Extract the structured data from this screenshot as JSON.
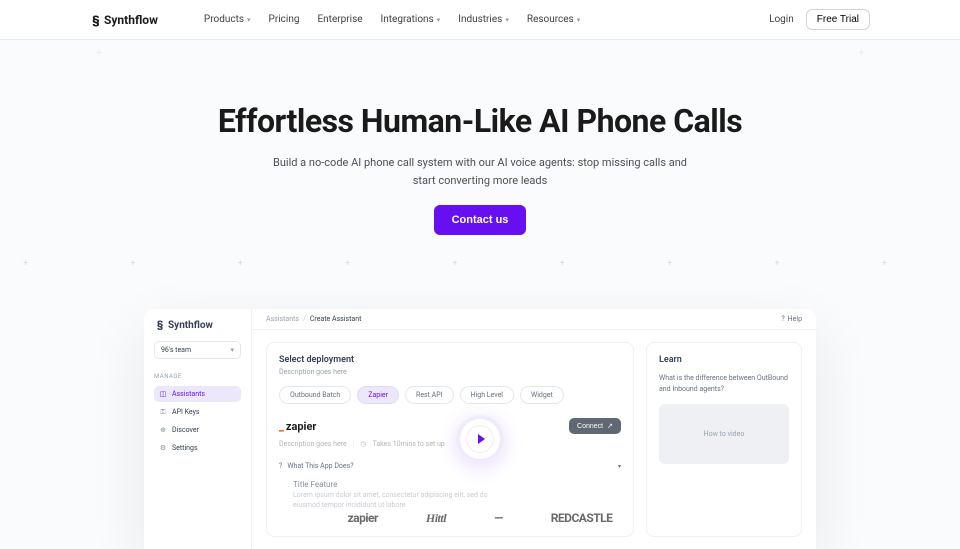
{
  "brand": "Synthflow",
  "nav": {
    "items": [
      {
        "label": "Products",
        "dropdown": true
      },
      {
        "label": "Pricing",
        "dropdown": false
      },
      {
        "label": "Enterprise",
        "dropdown": false
      },
      {
        "label": "Integrations",
        "dropdown": true
      },
      {
        "label": "Industries",
        "dropdown": true
      },
      {
        "label": "Resources",
        "dropdown": true
      }
    ],
    "login": "Login",
    "trial": "Free Trial"
  },
  "hero": {
    "title": "Effortless Human-Like AI Phone Calls",
    "subtitle": "Build a no-code AI phone call system with our AI voice agents: stop missing calls and start converting more leads",
    "cta": "Contact us"
  },
  "preview": {
    "brand": "Synthflow",
    "team": "96's team",
    "sidebar_section": "Manage",
    "sidebar": {
      "items": [
        {
          "label": "Assistants",
          "icon": "◫",
          "active": true
        },
        {
          "label": "API Keys",
          "icon": "⚿",
          "active": false
        },
        {
          "label": "Discover",
          "icon": "⊕",
          "active": false
        },
        {
          "label": "Settings",
          "icon": "⚙",
          "active": false
        }
      ]
    },
    "breadcrumb": {
      "root": "Assistants",
      "current": "Create Assistant"
    },
    "help": "Help",
    "deployment": {
      "title": "Select deployment",
      "subtitle": "Description goes here",
      "pills": [
        "Outbound Batch",
        "Zapier",
        "Rest API",
        "High Level",
        "Widget"
      ],
      "selected": "Zapier",
      "provider_name": "zapier",
      "provider_desc": "Description goes here",
      "provider_time": "Takes 10mins to set up",
      "connect": "Connect",
      "accordion": "What This App Does?",
      "feature_title": "Title Feature",
      "feature_desc": "Lorem ipsum dolor sit amet, consectetur adipiscing elit, sed do eiusmod tempor incididunt ut labore"
    },
    "learn": {
      "title": "Learn",
      "question": "What is the difference between OutBound and Inbound agents?",
      "video_label": "How to video"
    }
  },
  "logos": [
    "zapier",
    "Hittl",
    "—",
    "REDCASTLE"
  ]
}
